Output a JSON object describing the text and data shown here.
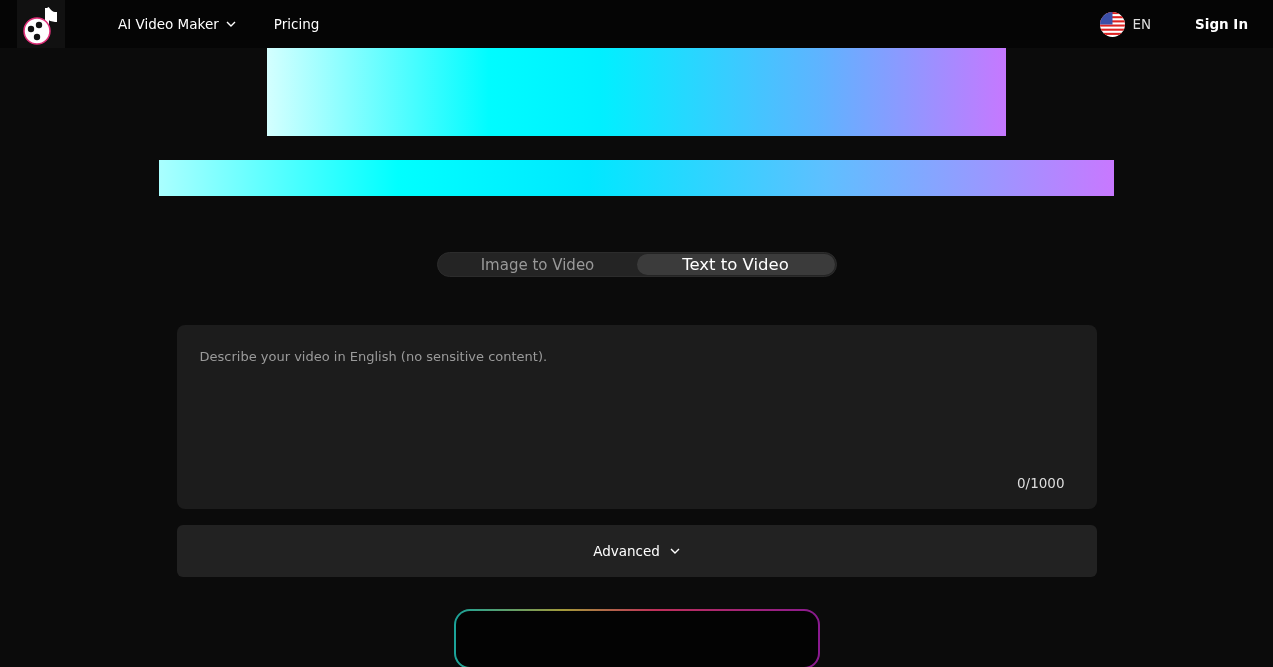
{
  "nav": {
    "items": [
      {
        "label": "AI Video Maker",
        "kind": "dropdown"
      },
      {
        "label": "Pricing",
        "kind": "link"
      }
    ],
    "language": "EN",
    "sign_in": "Sign In"
  },
  "tabs": [
    {
      "label": "Image to Video",
      "selected": false
    },
    {
      "label": "Text to Video",
      "selected": true
    }
  ],
  "prompt": {
    "placeholder": "Describe your video in English (no sensitive content).",
    "counter": "0/1000"
  },
  "advanced": {
    "label": "Advanced"
  }
}
